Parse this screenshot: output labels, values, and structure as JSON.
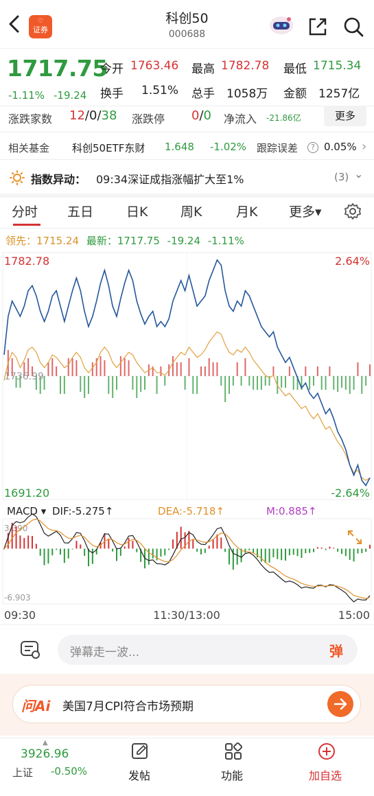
{
  "header": {
    "title": "科创50",
    "code": "000688",
    "badge_top": "♡",
    "badge_label": "证券"
  },
  "quote": {
    "price": "1717.75",
    "change_pct": "-1.11%",
    "change": "-19.24",
    "open_label": "今开",
    "open": "1763.46",
    "high_label": "最高",
    "high": "1782.78",
    "low_label": "最低",
    "low": "1715.34",
    "turnover_label": "换手",
    "turnover": "1.51%",
    "volume_label": "总手",
    "volume": "1058万",
    "amount_label": "金额",
    "amount": "1257亿"
  },
  "breadth": {
    "label": "涨跌家数",
    "up": "12",
    "sep1": "/",
    "flat": "0",
    "sep2": "/",
    "down": "38",
    "limit_label": "涨跌停",
    "limit_up": "0",
    "sep3": "/",
    "limit_down": "0",
    "inflow_label": "净流入",
    "inflow": "-21.86亿",
    "more": "更多"
  },
  "fund": {
    "label": "相关基金",
    "name": "科创50ETF东财",
    "price": "1.648",
    "pct": "-1.02%",
    "err_label": "跟踪误差",
    "help": "?",
    "err": "0.05%",
    "arrow": "›"
  },
  "alert": {
    "label": "指数异动：",
    "text": "09:34深证成指涨幅扩大至1%",
    "count": "(3)",
    "chevron": "⌄"
  },
  "tabs": [
    {
      "label": "分时"
    },
    {
      "label": "五日"
    },
    {
      "label": "日K"
    },
    {
      "label": "周K"
    },
    {
      "label": "月K"
    },
    {
      "label": "更多▾"
    }
  ],
  "infoline": {
    "lead_label": "领先：",
    "lead": "1715.24",
    "latest_label": "最新：",
    "latest": "1717.75",
    "change": "-19.24",
    "pct": "-1.11%"
  },
  "chart_data": {
    "type": "line",
    "price_axis": {
      "top": "1782.78",
      "bottom": "1691.20",
      "top_pct": "2.64%",
      "bottom_pct": "-2.64%",
      "ref": "1736.99"
    },
    "time_labels": [
      "09:30",
      "11:30/13:00",
      "15:00"
    ],
    "price_series": [
      1745,
      1760,
      1766,
      1763,
      1760,
      1764,
      1770,
      1772,
      1768,
      1762,
      1758,
      1762,
      1768,
      1770,
      1764,
      1758,
      1764,
      1770,
      1775,
      1770,
      1762,
      1756,
      1760,
      1766,
      1773,
      1778,
      1772,
      1764,
      1760,
      1767,
      1773,
      1778,
      1774,
      1766,
      1761,
      1757,
      1760,
      1762,
      1756,
      1758,
      1756,
      1759,
      1766,
      1770,
      1774,
      1770,
      1776,
      1770,
      1764,
      1766,
      1768,
      1774,
      1778,
      1782,
      1780,
      1770,
      1764,
      1762,
      1766,
      1764,
      1770,
      1768,
      1764,
      1760,
      1756,
      1754,
      1752,
      1754,
      1748,
      1745,
      1742,
      1744,
      1740,
      1736,
      1732,
      1734,
      1730,
      1728,
      1730,
      1726,
      1722,
      1724,
      1720,
      1715,
      1712,
      1708,
      1702,
      1698,
      1702,
      1696,
      1694,
      1697
    ],
    "lead_series": [
      1735,
      1742,
      1746,
      1744,
      1740,
      1743,
      1747,
      1748,
      1746,
      1742,
      1740,
      1742,
      1745,
      1744,
      1742,
      1740,
      1741,
      1744,
      1746,
      1744,
      1740,
      1738,
      1740,
      1742,
      1746,
      1748,
      1746,
      1742,
      1740,
      1742,
      1744,
      1746,
      1745,
      1742,
      1740,
      1738,
      1739,
      1740,
      1738,
      1738,
      1737,
      1739,
      1742,
      1744,
      1746,
      1745,
      1748,
      1746,
      1744,
      1745,
      1747,
      1750,
      1752,
      1754,
      1753,
      1749,
      1746,
      1745,
      1747,
      1746,
      1748,
      1746,
      1743,
      1741,
      1739,
      1737,
      1736,
      1737,
      1733,
      1731,
      1729,
      1730,
      1728,
      1726,
      1724,
      1725,
      1722,
      1720,
      1722,
      1719,
      1716,
      1717,
      1714,
      1711,
      1709,
      1706,
      1702,
      1699,
      1700,
      1697,
      1696,
      1697
    ],
    "macd_label": "MACD",
    "dif_label": "DIF:",
    "dif": "-5.275",
    "dea_label": "DEA:",
    "dea": "-5.718",
    "m_label": "M:",
    "m": "0.885",
    "macd_top": "3.390",
    "macd_bottom": "-6.903"
  },
  "danmu": {
    "placeholder": "弹幕走一波...",
    "button": "弹"
  },
  "ai": {
    "logo": "问Ai",
    "text": "美国7月CPI符合市场预期"
  },
  "bottom": {
    "index_value": "3926.96",
    "index_name": "上证",
    "index_pct": "-0.50%",
    "post": "发帖",
    "func": "功能",
    "add": "加自选"
  },
  "colors": {
    "up": "#d63333",
    "down": "#2f9a3f",
    "price_line": "#24579a",
    "lead_line": "#e0a040",
    "accent": "#f05a2a"
  }
}
